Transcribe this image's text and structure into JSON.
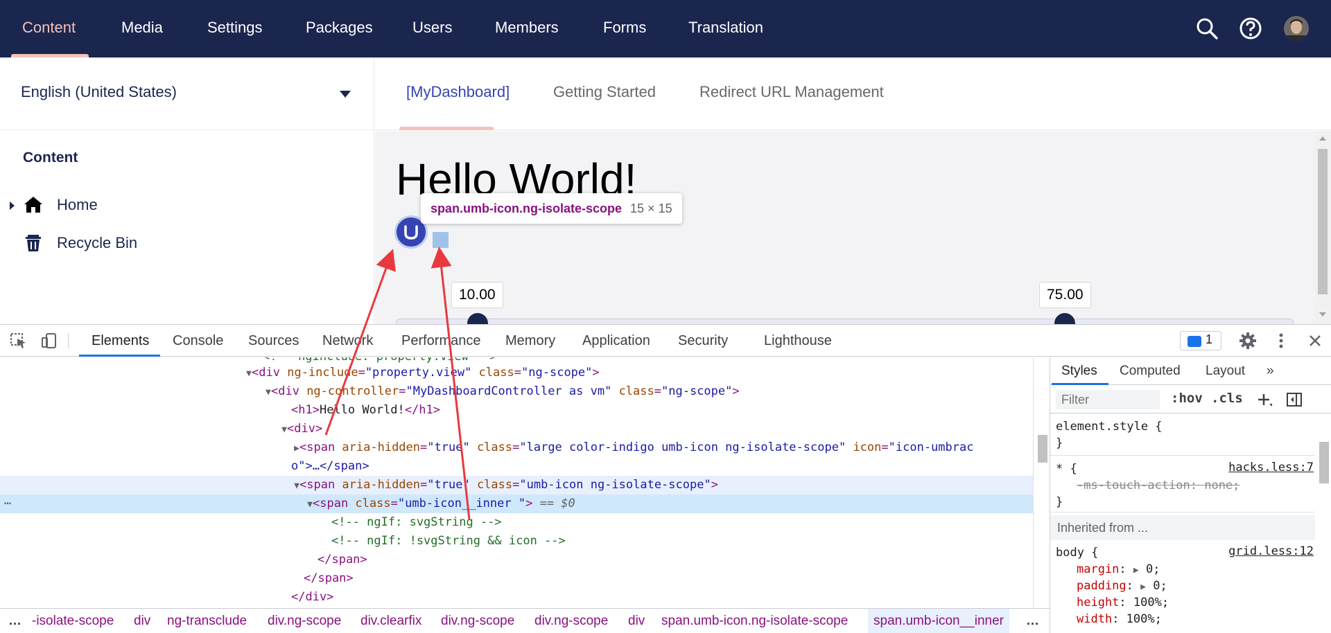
{
  "nav": {
    "items": [
      "Content",
      "Media",
      "Settings",
      "Packages",
      "Users",
      "Members",
      "Forms",
      "Translation"
    ],
    "active": "Content"
  },
  "sidebar": {
    "language": "English (United States)",
    "tree_title": "Content",
    "items": [
      {
        "label": "Home",
        "icon": "home-icon"
      },
      {
        "label": "Recycle Bin",
        "icon": "trash-icon"
      }
    ]
  },
  "dashboard": {
    "tabs": [
      "[MyDashboard]",
      "Getting Started",
      "Redirect URL Management"
    ],
    "active_tab": "[MyDashboard]",
    "heading": "Hello World!",
    "slider_min_value": "10.00",
    "slider_max_value": "75.00"
  },
  "inspector_tooltip": {
    "selector": "span.umb-icon.ng-isolate-scope",
    "size": "15 × 15"
  },
  "devtools": {
    "tabs": [
      "Elements",
      "Console",
      "Sources",
      "Network",
      "Performance",
      "Memory",
      "Application",
      "Security",
      "Lighthouse"
    ],
    "active_tab": "Elements",
    "issues_count": "1",
    "dom": {
      "line0": "<!-- ngInclude: property.view -->",
      "line1_tag_open": "<div",
      "line1_attr1": "ng-include",
      "line1_val1": "\"property.view\"",
      "line1_attr2": "class",
      "line1_val2": "\"ng-scope\"",
      "line2_attr1": "ng-controller",
      "line2_val1": "\"MyDashboardController as vm\"",
      "line2_attr2": "class",
      "line2_val2": "\"ng-scope\"",
      "line3_text": "Hello World!",
      "line5_attr1": "aria-hidden",
      "line5_val1": "\"true\"",
      "line5_attr2": "class",
      "line5_val2": "\"large color-indigo umb-icon ng-isolate-scope\"",
      "line5_attr3": "icon",
      "line5_val3": "\"icon-umbrac",
      "line6_text": "o\">…</span>",
      "line7_attr1": "aria-hidden",
      "line7_val1": "\"true\"",
      "line7_attr2": "class",
      "line7_val2": "\"umb-icon ng-isolate-scope\"",
      "line8_attr1": "class",
      "line8_val1": "\"umb-icon__inner \"",
      "line8_marker": "== $0",
      "line9_comment": "<!-- ngIf: svgString -->",
      "line10_comment": "<!-- ngIf: !svgString && icon -->"
    },
    "breadcrumbs": [
      "…",
      "-isolate-scope",
      "div",
      "ng-transclude",
      "div.ng-scope",
      "div.clearfix",
      "div.ng-scope",
      "div.ng-scope",
      "div",
      "span.umb-icon.ng-isolate-scope",
      "span.umb-icon__inner",
      "…"
    ],
    "styles": {
      "tabs": [
        "Styles",
        "Computed",
        "Layout",
        "»"
      ],
      "filter_placeholder": "Filter",
      "hov": ":hov",
      "cls": ".cls",
      "element_style": "element.style {",
      "close_brace": "}",
      "star_rule": "* {",
      "star_source": "hacks.less:7",
      "star_prop": "-ms-touch-action: none;",
      "inherited": "Inherited from ...",
      "body_rule": "body {",
      "body_source": "grid.less:12",
      "props": [
        {
          "name": "margin",
          "value": "0;",
          "arrow": true
        },
        {
          "name": "padding",
          "value": "0;",
          "arrow": true
        },
        {
          "name": "height",
          "value": "100%;",
          "arrow": false
        },
        {
          "name": "width",
          "value": "100%;",
          "arrow": false
        }
      ]
    }
  },
  "colors": {
    "nav_bg": "#1b264f",
    "accent_pink": "#f5c1bc",
    "umbraco_blue": "#3544b1",
    "arrow_red": "#e8393f",
    "devtools_blue": "#1a73e8"
  }
}
